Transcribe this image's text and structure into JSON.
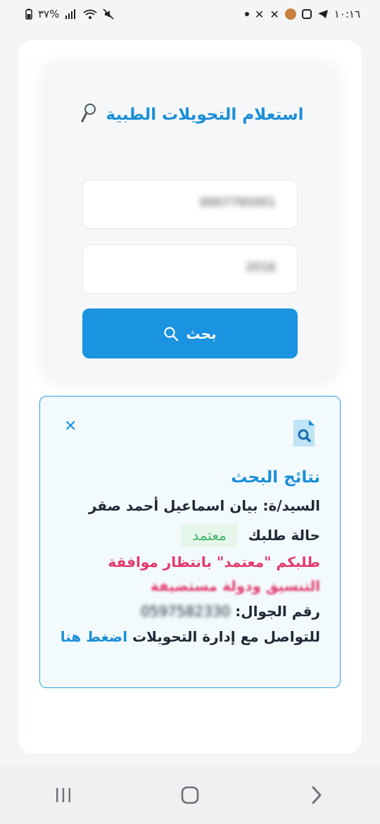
{
  "status_bar": {
    "time": "١٠:١٦",
    "battery": "٣٧%"
  },
  "form": {
    "title": "استعلام التحويلات الطبية",
    "title_icon": "magnifier-icon",
    "field1_value": "0007795001",
    "field2_value": "2016",
    "search_button_label": "بحث"
  },
  "results": {
    "title": "نتائج البحث",
    "name_label": "السيد/ة:",
    "name_value": "بيان اسماعيل أحمد صقر",
    "status_label": "حالة طلبك",
    "status_value": "معتمد",
    "message_line1": "طلبكم \"معتمد\" بانتظار موافقة",
    "message_line2": "التنسيق ودولة مستضيفة",
    "phone_label": "رقم الجوال:",
    "phone_value": "0597582330",
    "contact_text": "للتواصل مع إدارة التحويلات",
    "contact_link": "اضغط هنا",
    "close_icon": "close-icon"
  },
  "colors": {
    "accent": "#1a93e1",
    "success": "#40b56b",
    "warning": "#e23a6b"
  }
}
